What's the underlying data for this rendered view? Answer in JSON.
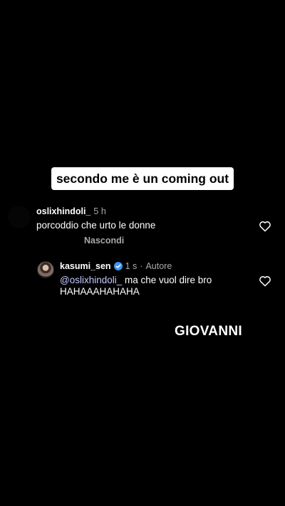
{
  "overlay": {
    "caption": "secondo me è un coming out",
    "name_sticker": "GIOVANNI"
  },
  "comments": [
    {
      "username": "oslixhindoli_",
      "time": "5 h",
      "text": "porcoddio che urto le donne",
      "action": "Nascondi"
    },
    {
      "username": "kasumi_sen",
      "verified": true,
      "time": "1 s",
      "separator": "·",
      "role": "Autore",
      "mention": "@oslixhindoli_",
      "text_line1_rest": " ma che vuol dire bro",
      "text_line2": "HAHAAAHAHAHA"
    }
  ],
  "icons": {
    "like": "heart-outline-icon",
    "verified": "verified-badge-icon"
  },
  "colors": {
    "background": "#000000",
    "caption_bg": "#ffffff",
    "muted_text": "#a8a8a8",
    "mention": "#c5cbff",
    "verified": "#3897f0"
  }
}
